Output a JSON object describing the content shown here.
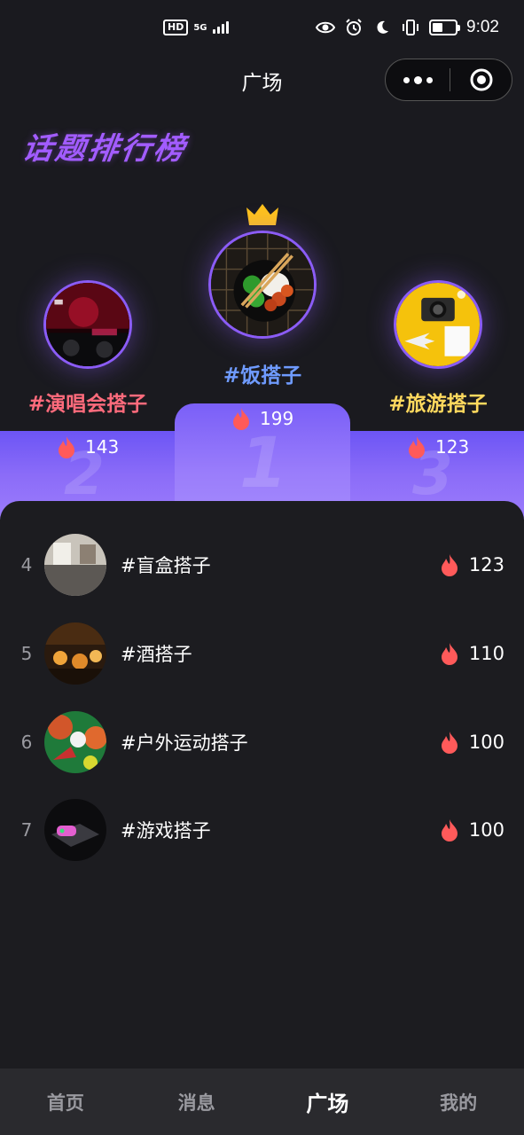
{
  "status_bar": {
    "network": "HD",
    "signal_label": "5G",
    "time": "9:02",
    "battery_percent": 45
  },
  "nav": {
    "title": "广场"
  },
  "heading": "话题排行榜",
  "podium": [
    {
      "rank": 1,
      "rank_digit": "1",
      "name": "#饭搭子",
      "heat": "199",
      "color": "#6f9bff"
    },
    {
      "rank": 2,
      "rank_digit": "2",
      "name": "#演唱会搭子",
      "heat": "143",
      "color": "#ff6b7c"
    },
    {
      "rank": 3,
      "rank_digit": "3",
      "name": "#旅游搭子",
      "heat": "123",
      "color": "#ffd95e"
    }
  ],
  "list": [
    {
      "rank": "4",
      "name": "#盲盒搭子",
      "heat": "123"
    },
    {
      "rank": "5",
      "name": "#酒搭子",
      "heat": "110"
    },
    {
      "rank": "6",
      "name": "#户外运动搭子",
      "heat": "100"
    },
    {
      "rank": "7",
      "name": "#游戏搭子",
      "heat": "100"
    }
  ],
  "tabs": [
    {
      "label": "首页"
    },
    {
      "label": "消息"
    },
    {
      "label": "广场",
      "active": true
    },
    {
      "label": "我的"
    }
  ],
  "colors": {
    "accent": "#8b5cf6",
    "fire": "#ff5a5a",
    "background": "#1a1a1f"
  }
}
